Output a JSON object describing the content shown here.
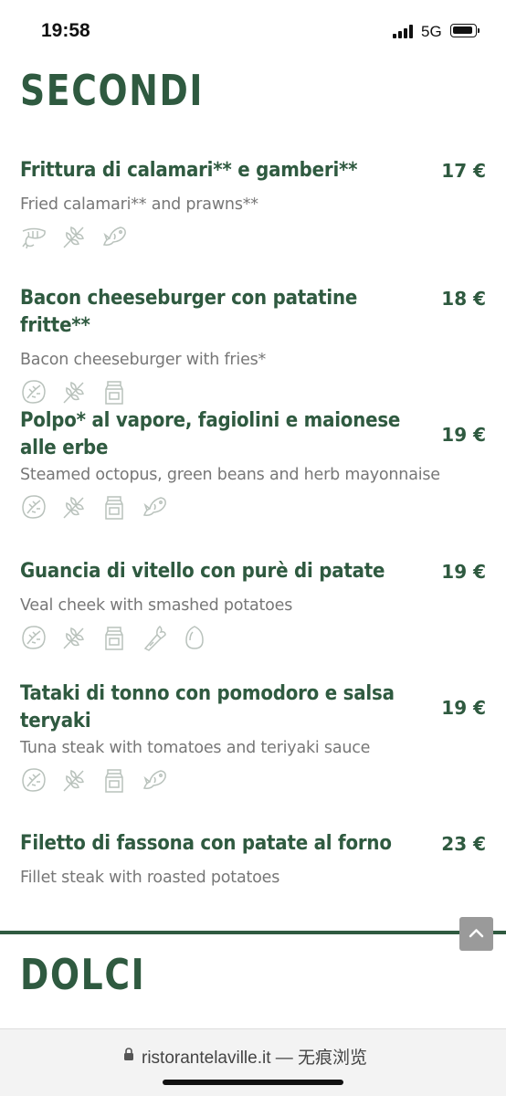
{
  "status_bar": {
    "time": "19:58",
    "network": "5G"
  },
  "sections": {
    "secondi_title": "SECONDI",
    "dolci_title": "DOLCI"
  },
  "items": [
    {
      "name": "Frittura di calamari** e gamberi**",
      "price": "17 €",
      "description": "Fried calamari** and prawns**",
      "icons": [
        "shrimp-icon",
        "wheat-icon",
        "fish-icon"
      ]
    },
    {
      "name": "Bacon cheeseburger con patatine fritte**",
      "price": "18 €",
      "description": "Bacon cheeseburger with fries*",
      "icons": [
        "nut-icon",
        "wheat-icon",
        "milk-carton-icon"
      ]
    },
    {
      "name": "Polpo* al vapore, fagiolini e maionese alle erbe",
      "price": "19 €",
      "description": "Steamed octopus, green beans and herb mayonnaise",
      "icons": [
        "nut-icon",
        "wheat-icon",
        "milk-carton-icon",
        "fish-icon"
      ]
    },
    {
      "name": "Guancia di vitello con purè di patate",
      "price": "19 €",
      "description": "Veal cheek with smashed potatoes",
      "icons": [
        "nut-icon",
        "wheat-icon",
        "milk-carton-icon",
        "celery-icon",
        "egg-icon"
      ]
    },
    {
      "name": "Tataki di tonno con pomodoro e salsa teryaki",
      "price": "19 €",
      "description": "Tuna steak with tomatoes and teriyaki sauce",
      "icons": [
        "nut-icon",
        "wheat-icon",
        "milk-carton-icon",
        "fish-icon"
      ]
    },
    {
      "name": "Filetto di fassona con patate al forno",
      "price": "23 €",
      "description": "Fillet steak with roasted potatoes",
      "icons": []
    }
  ],
  "browser": {
    "url": "ristorantelaville.it — 无痕浏览"
  },
  "colors": {
    "accent_green": "#2f5a40",
    "description_gray": "#777777",
    "icon_gray": "#b9c2bc"
  }
}
